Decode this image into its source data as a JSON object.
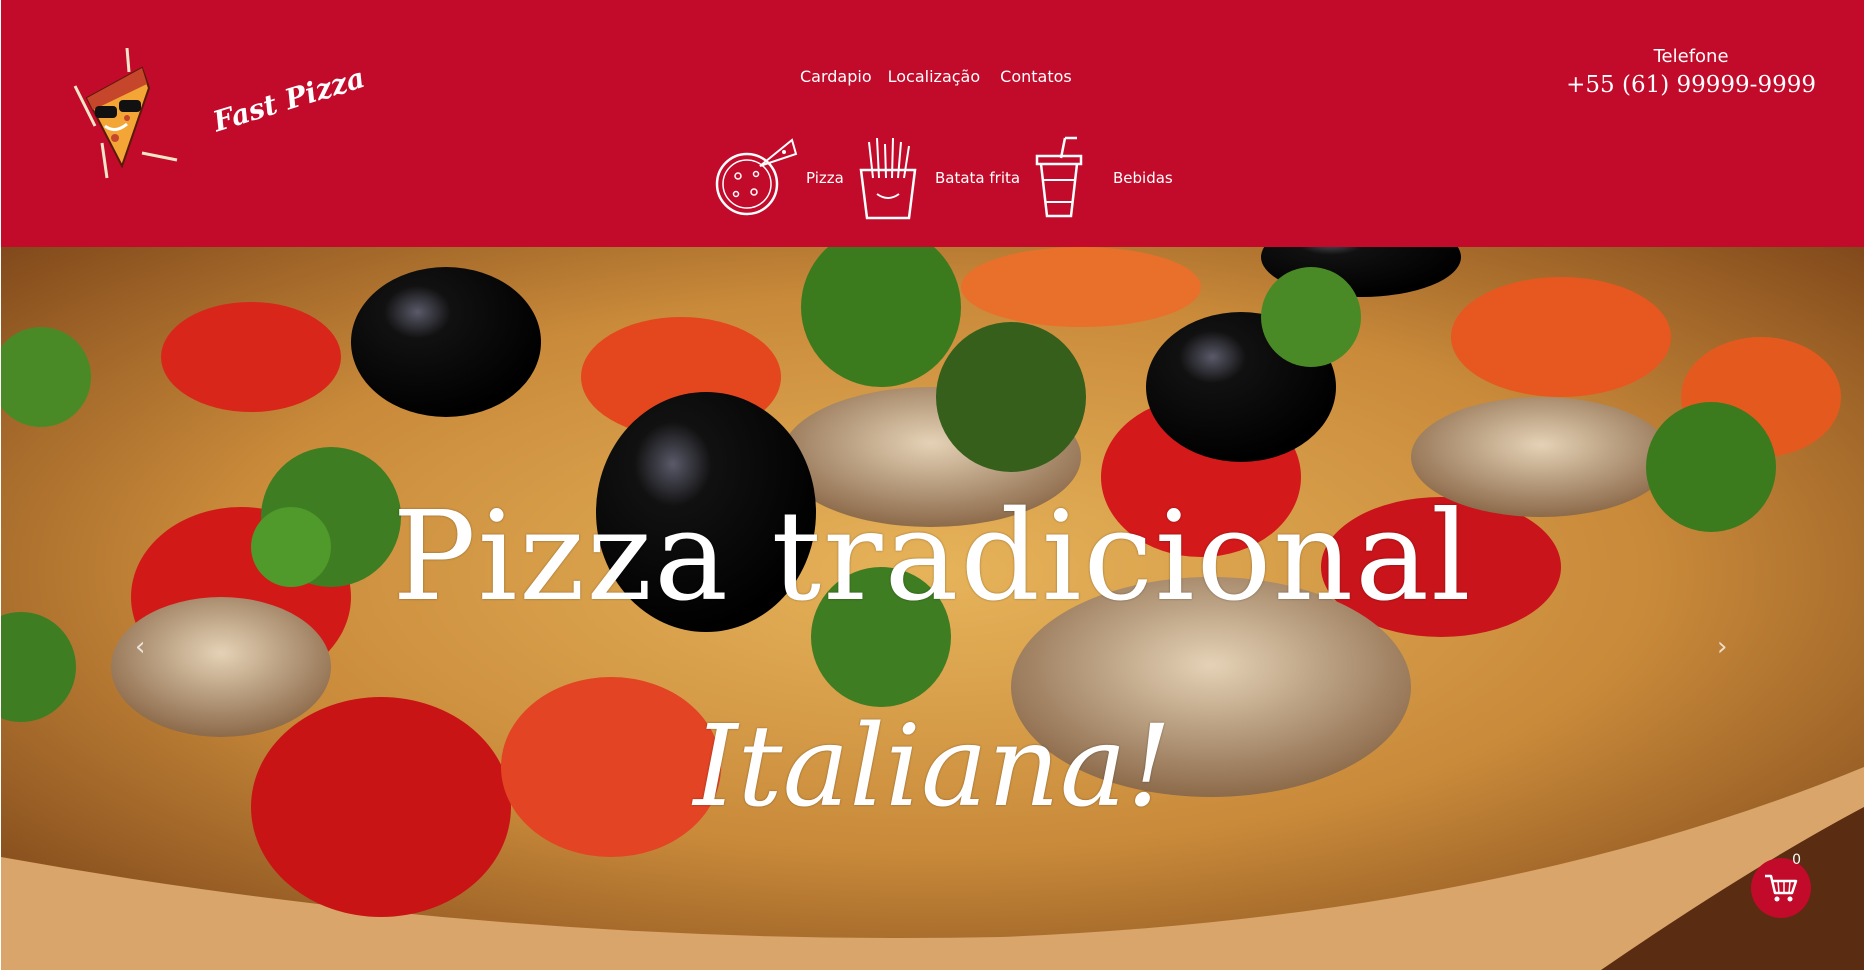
{
  "brand": {
    "name": "Fast Pizza"
  },
  "nav": {
    "items": [
      {
        "label": "Cardapio"
      },
      {
        "label": "Localização"
      },
      {
        "label": "Contatos"
      }
    ]
  },
  "contact": {
    "label": "Telefone",
    "phone": "+55 (61) 99999-9999"
  },
  "categories": [
    {
      "label": "Pizza",
      "icon": "pizza-icon"
    },
    {
      "label": "Batata frita",
      "icon": "fries-icon"
    },
    {
      "label": "Bebidas",
      "icon": "drink-icon"
    }
  ],
  "hero": {
    "title": "Pizza tradicional",
    "subtitle": "Italiana!"
  },
  "cart": {
    "count": "0",
    "icon": "cart-icon"
  },
  "colors": {
    "brand_red": "#c20a2a",
    "text": "#ffffff"
  }
}
